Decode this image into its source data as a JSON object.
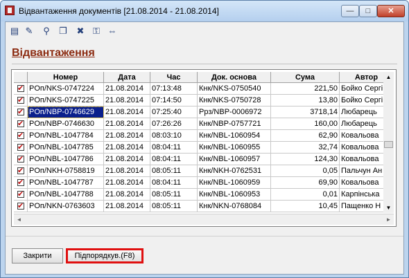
{
  "window": {
    "title": "Відвантаження документів [21.08.2014 - 21.08.2014]",
    "controls": {
      "minimize": "—",
      "maximize": "□",
      "close": "✕"
    }
  },
  "toolbar": {
    "icons": [
      "calendar-icon",
      "edit-icon",
      "search-icon",
      "copy-icon",
      "delete-icon",
      "binoculars-icon",
      "resize-columns-icon"
    ],
    "glyphs": [
      "▤",
      "✎",
      "⚲",
      "❐",
      "✖",
      "⚿",
      "⇔"
    ]
  },
  "heading": "Відвантаження",
  "table": {
    "columns": [
      "Номер",
      "Дата",
      "Час",
      "Док. основа",
      "Сума",
      "Автор"
    ],
    "rows": [
      [
        "POп/NKS-0747224",
        "21.08.2014",
        "07:13:48",
        "Кнк/NKS-0750540",
        "221,50",
        "Бойко Сергі"
      ],
      [
        "POп/NKS-0747225",
        "21.08.2014",
        "07:14:50",
        "Кнк/NKS-0750728",
        "13,80",
        "Бойко Сергі"
      ],
      [
        "POп/NBP-0746629",
        "21.08.2014",
        "07:25:40",
        "Ррз/NBP-0006972",
        "3718,14",
        "Любарець"
      ],
      [
        "POп/NBP-0746630",
        "21.08.2014",
        "07:26:26",
        "Кнк/NBP-0757721",
        "160,00",
        "Любарець"
      ],
      [
        "POп/NBL-1047784",
        "21.08.2014",
        "08:03:10",
        "Кнк/NBL-1060954",
        "62,90",
        "Ковальова"
      ],
      [
        "POп/NBL-1047785",
        "21.08.2014",
        "08:04:11",
        "Кнк/NBL-1060955",
        "32,74",
        "Ковальова"
      ],
      [
        "POп/NBL-1047786",
        "21.08.2014",
        "08:04:11",
        "Кнк/NBL-1060957",
        "124,30",
        "Ковальова"
      ],
      [
        "POп/NKH-0758819",
        "21.08.2014",
        "08:05:11",
        "Кнк/NKH-0762531",
        "0,05",
        "Пальчун Ан"
      ],
      [
        "POп/NBL-1047787",
        "21.08.2014",
        "08:04:11",
        "Кнк/NBL-1060959",
        "69,90",
        "Ковальова"
      ],
      [
        "POп/NBL-1047788",
        "21.08.2014",
        "08:05:11",
        "Кнк/NBL-1060953",
        "0,01",
        "Карпінська"
      ],
      [
        "POп/NKN-0763603",
        "21.08.2014",
        "08:05:11",
        "Кнк/NKN-0768084",
        "10,45",
        "Пащенко Н"
      ]
    ],
    "selected_row": 2
  },
  "buttons": {
    "close": "Закрити",
    "subordinate": "Підпорядкув.(F8)"
  },
  "scroll": {
    "up": "▲",
    "down": "▼",
    "left": "◄",
    "right": "►"
  }
}
